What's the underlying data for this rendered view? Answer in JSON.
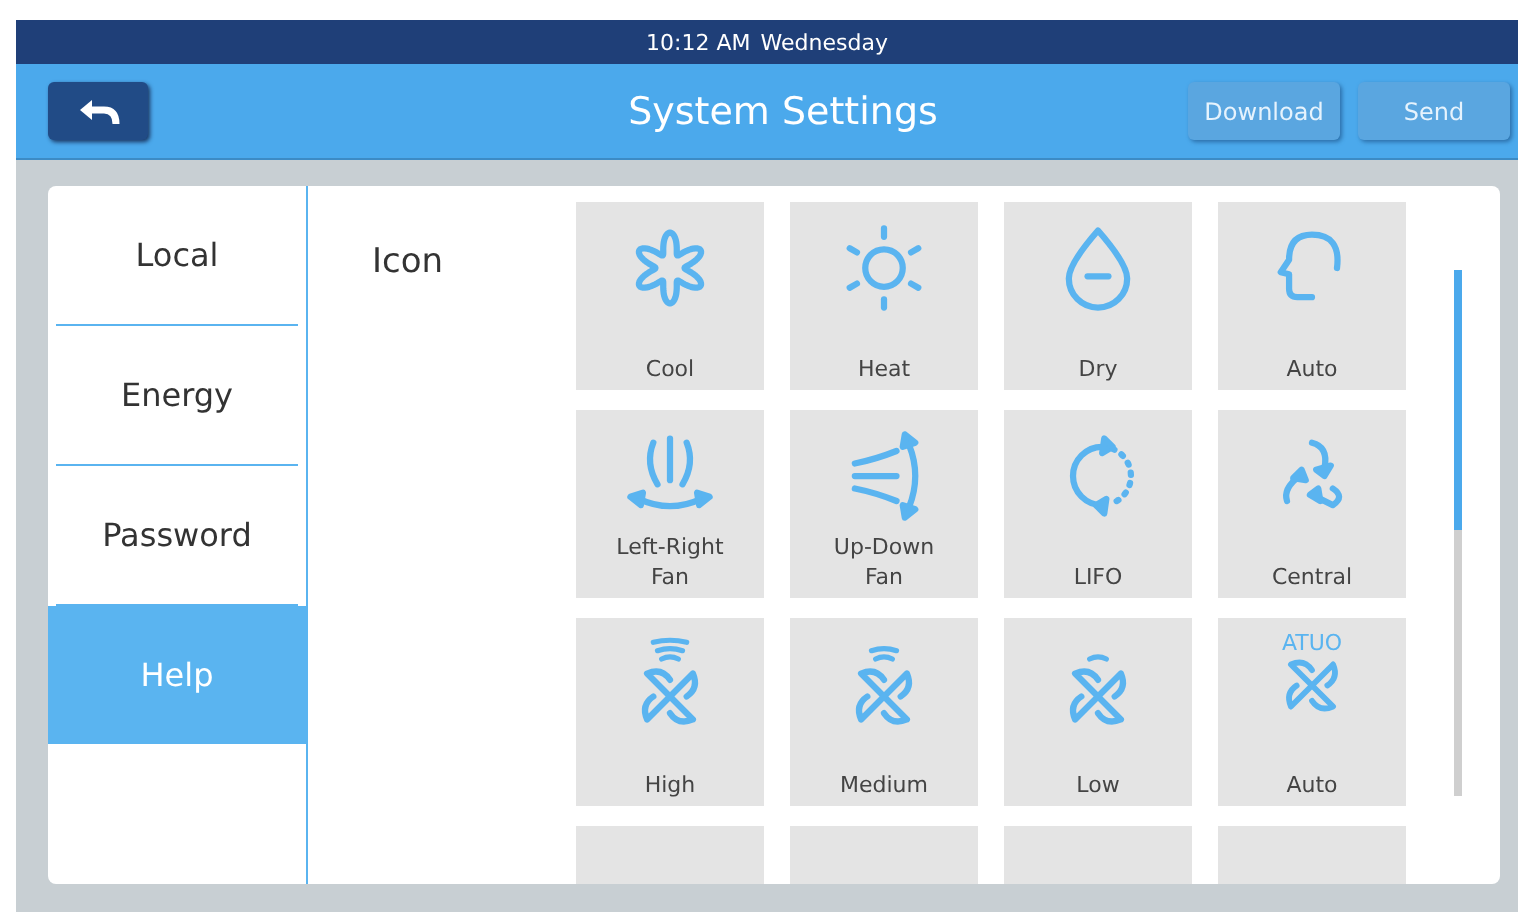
{
  "status_bar": {
    "time": "10:12 AM",
    "day": "Wednesday"
  },
  "header": {
    "title": "System Settings",
    "buttons": [
      {
        "label": "Download",
        "disabled": true
      },
      {
        "label": "Send",
        "disabled": true
      }
    ]
  },
  "sidebar": {
    "items": [
      {
        "label": "Local",
        "selected": false
      },
      {
        "label": "Energy",
        "selected": false
      },
      {
        "label": "Password",
        "selected": false
      },
      {
        "label": "Help",
        "selected": true
      }
    ]
  },
  "section": {
    "label": "Icon"
  },
  "tiles": [
    {
      "kind": "cool",
      "label": "Cool"
    },
    {
      "kind": "heat",
      "label": "Heat"
    },
    {
      "kind": "dry",
      "label": "Dry"
    },
    {
      "kind": "auto",
      "label": "Auto"
    },
    {
      "kind": "lr-fan",
      "label": "Left-Right Fan"
    },
    {
      "kind": "ud-fan",
      "label": "Up-Down Fan"
    },
    {
      "kind": "lifo",
      "label": "LIFO"
    },
    {
      "kind": "central",
      "label": "Central"
    },
    {
      "kind": "fan-high",
      "label": "High"
    },
    {
      "kind": "fan-medium",
      "label": "Medium"
    },
    {
      "kind": "fan-low",
      "label": "Low"
    },
    {
      "kind": "fan-auto",
      "label": "Auto",
      "badge": "ATUO"
    },
    {
      "kind": "blank"
    },
    {
      "kind": "blank"
    },
    {
      "kind": "blank"
    },
    {
      "kind": "blank"
    }
  ]
}
